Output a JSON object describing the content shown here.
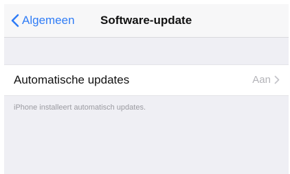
{
  "navbar": {
    "back_label": "Algemeen",
    "title": "Software-update",
    "back_icon": "chevron-left-icon"
  },
  "settings": {
    "auto_updates": {
      "label": "Automatische updates",
      "value": "Aan",
      "chevron_icon": "chevron-right-icon"
    },
    "footer": "iPhone installeert automatisch updates."
  },
  "colors": {
    "accent": "#2f7cf6",
    "background": "#efeff4",
    "cell": "#ffffff",
    "secondary_text": "#b3b3b8"
  }
}
